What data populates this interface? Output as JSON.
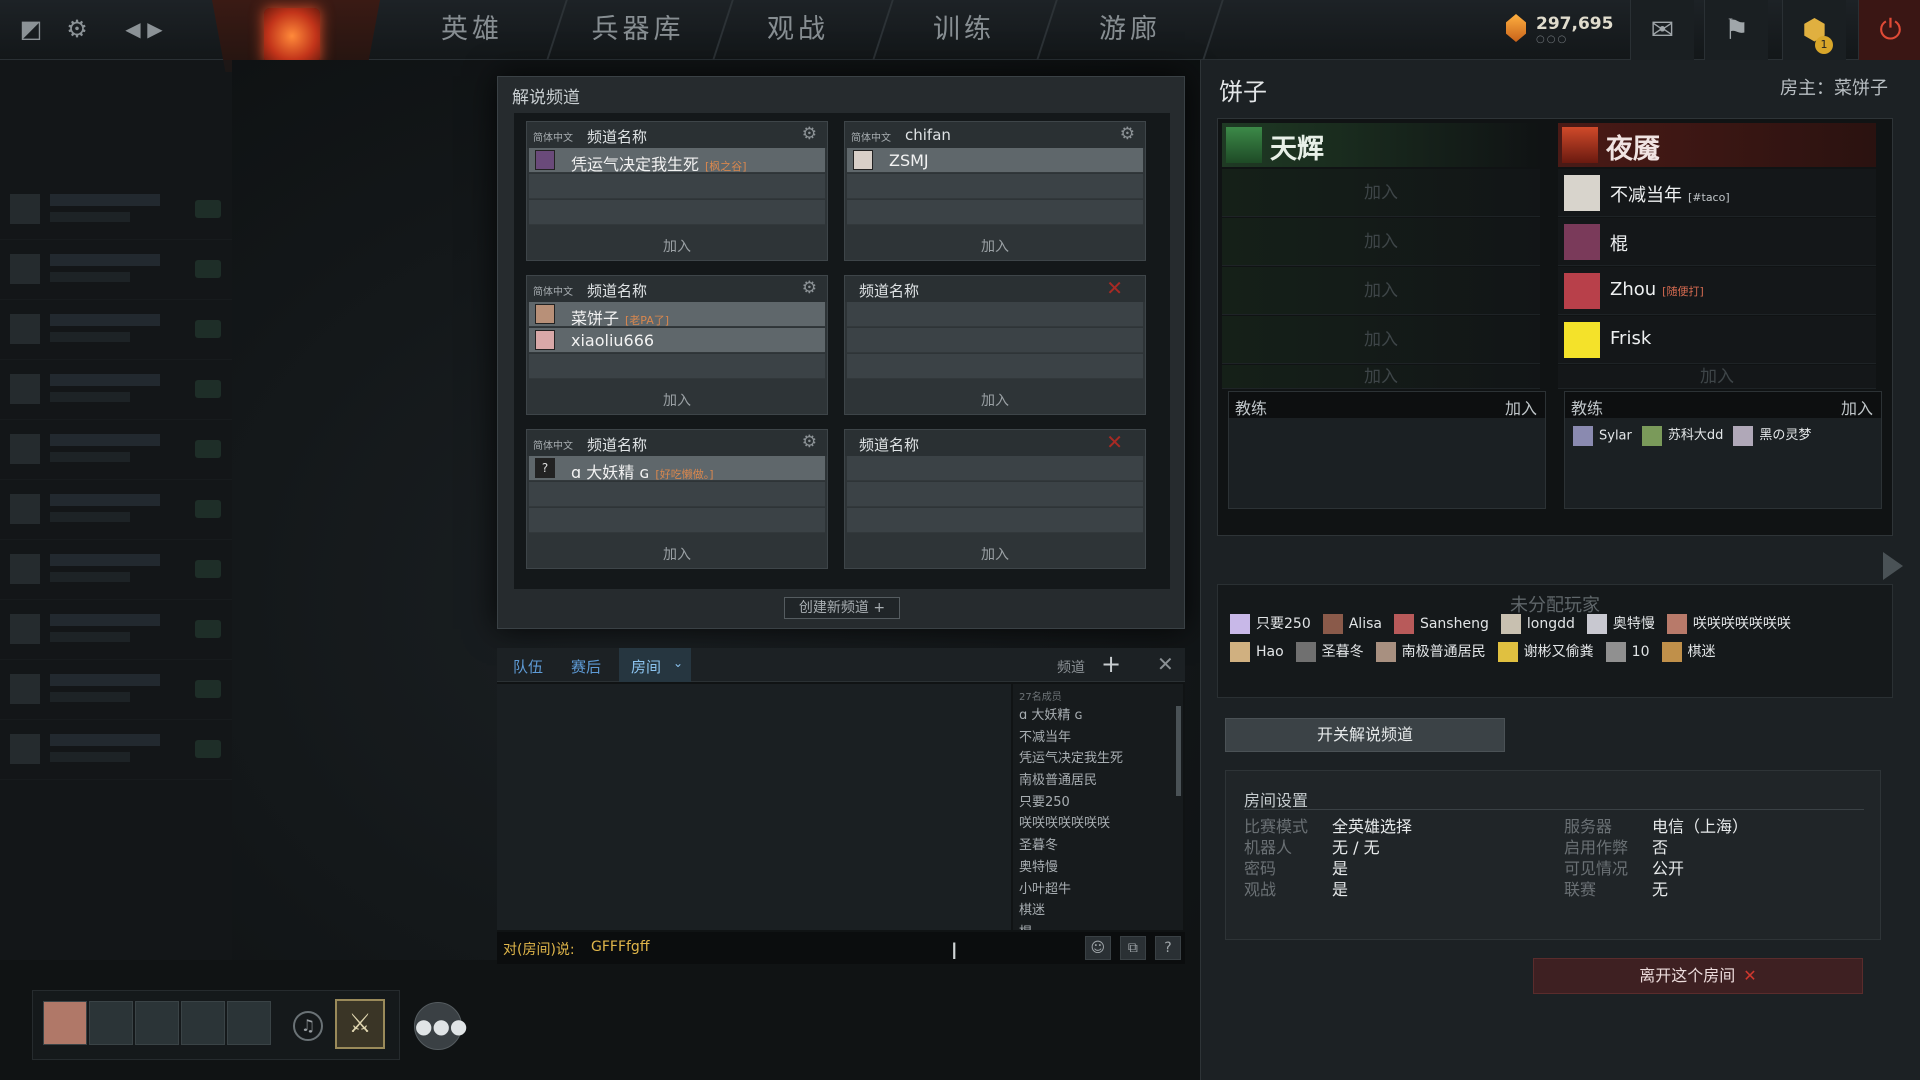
{
  "topbar": {
    "nav": [
      "英雄",
      "兵器库",
      "观战",
      "训练",
      "游廊"
    ],
    "currency": "297,695",
    "currency_sub": "○○○",
    "notification_count": "1"
  },
  "broadcast": {
    "title": "解说频道",
    "create_button": "创建新频道",
    "channels": [
      {
        "lang": "简体中文",
        "name": "频道名称",
        "members": [
          {
            "name": "凭运气决定我生死",
            "tag": "[枫之谷]"
          }
        ],
        "join": "加入"
      },
      {
        "lang": "简体中文",
        "name": "chifan",
        "members": [
          {
            "name": "ZSMJ",
            "tag": ""
          }
        ],
        "join": "加入"
      },
      {
        "lang": "简体中文",
        "name": "频道名称",
        "members": [
          {
            "name": "菜饼子",
            "tag": "[老PA了]"
          },
          {
            "name": "xiaoliu666",
            "tag": ""
          }
        ],
        "join": "加入"
      },
      {
        "lang": "",
        "name": "频道名称",
        "members": [],
        "join": "加入"
      },
      {
        "lang": "简体中文",
        "name": "频道名称",
        "members": [
          {
            "name": "ɑ 大妖精 ɢ",
            "tag": "[好吃懒做。]"
          }
        ],
        "join": "加入"
      },
      {
        "lang": "",
        "name": "频道名称",
        "members": [],
        "join": "加入"
      }
    ]
  },
  "chat": {
    "tabs": [
      "队伍",
      "赛后",
      "房间"
    ],
    "channels_label": "频道",
    "member_count": "27名成员",
    "members": [
      "ɑ 大妖精 ɢ",
      "不减当年",
      "凭运气决定我生死",
      "南极普通居民",
      "只要250",
      "咲咲咲咲咲咲咲",
      "圣暮冬",
      "奥特慢",
      "小叶超牛",
      "棋迷",
      "棍"
    ],
    "input_label": "对(房间)说:",
    "input_text": "GFFFfgff"
  },
  "lobby": {
    "name": "饼子",
    "host": "房主：菜饼子",
    "radiant": {
      "name": "天辉",
      "join": "加入",
      "slots": [
        "",
        "",
        "",
        "",
        ""
      ]
    },
    "dire": {
      "name": "夜魇",
      "join": "加入",
      "players": [
        {
          "name": "不减当年",
          "tag": "[#taco]"
        },
        {
          "name": "棍",
          "tag": ""
        },
        {
          "name": "Zhou",
          "tag": "[随便打]"
        },
        {
          "name": "Frisk",
          "tag": ""
        }
      ]
    },
    "coach_label": "教练",
    "coach_join": "加入",
    "dire_coaches": [
      "Sylar",
      "苏科大dd",
      "黑の灵梦"
    ],
    "unassigned_title": "未分配玩家",
    "unassigned_row1": [
      "只要250",
      "Alisa",
      "Sansheng",
      "longdd",
      "奥特慢",
      "咲咲咲咲咲咲咲"
    ],
    "unassigned_row2": [
      "Hao",
      "圣暮冬",
      "南极普通居民",
      "谢彬又偷粪",
      "10",
      "棋迷"
    ],
    "broadcast_toggle": "开关解说频道",
    "settings_title": "房间设置",
    "settings_left": [
      {
        "k": "比赛模式",
        "v": "全英雄选择"
      },
      {
        "k": "机器人",
        "v": "无 / 无"
      },
      {
        "k": "密码",
        "v": "是"
      },
      {
        "k": "观战",
        "v": "是"
      }
    ],
    "settings_right": [
      {
        "k": "服务器",
        "v": "电信（上海）"
      },
      {
        "k": "启用作弊",
        "v": "否"
      },
      {
        "k": "可见情况",
        "v": "公开"
      },
      {
        "k": "联赛",
        "v": "无"
      }
    ],
    "leave_button": "离开这个房间"
  }
}
